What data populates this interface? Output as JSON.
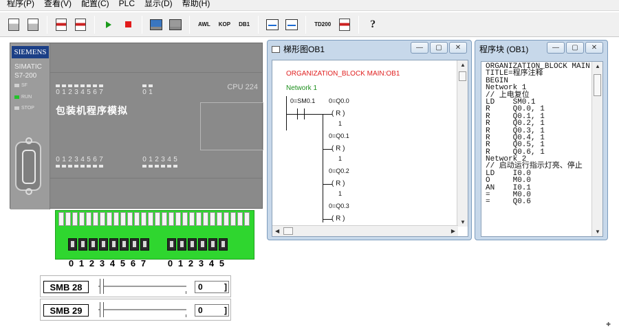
{
  "menubar": {
    "items": [
      "程序(P)",
      "查看(V)",
      "配置(C)",
      "PLC",
      "显示(D)",
      "帮助(H)"
    ]
  },
  "toolbar": {
    "awl_label": "AWL",
    "kop_label": "KOP",
    "db1_label": "DB1",
    "td200_label": "TD200",
    "help_glyph": "?"
  },
  "plc": {
    "brand": "SIEMENS",
    "series_line1": "SIMATIC",
    "series_line2": "S7-200",
    "led_sf": "SF",
    "led_run": "RUN",
    "led_stop": "STOP",
    "cpu_model": "CPU 224",
    "program_title": "包装机程序模拟",
    "input_nums_a": [
      "0",
      "1",
      "2",
      "3",
      "4",
      "5",
      "6",
      "7"
    ],
    "input_nums_b": [
      "0",
      "1"
    ],
    "output_nums_a": [
      "0",
      "1",
      "2",
      "3",
      "4",
      "5",
      "6",
      "7"
    ],
    "output_nums_b": [
      "0",
      "1",
      "2",
      "3",
      "4",
      "5"
    ]
  },
  "switches": {
    "nums_a": [
      "0",
      "1",
      "2",
      "3",
      "4",
      "5",
      "6",
      "7"
    ],
    "nums_b": [
      "0",
      "1",
      "2",
      "3",
      "4",
      "5"
    ]
  },
  "smb": [
    {
      "label": "SMB 28",
      "value": "0",
      "value_closing": "]"
    },
    {
      "label": "SMB 29",
      "value": "0",
      "value_closing": "]"
    }
  ],
  "ladder_window": {
    "title": "梯形图OB1",
    "org_block": "ORGANIZATION_BLOCK MAIN:OB1",
    "network": "Network 1",
    "contact": "0=SM0.1",
    "coils": [
      {
        "address": "0=Q0.0",
        "symbol": "( R )",
        "count": "1"
      },
      {
        "address": "0=Q0.1",
        "symbol": "( R )",
        "count": "1"
      },
      {
        "address": "0=Q0.2",
        "symbol": "( R )",
        "count": "1"
      },
      {
        "address": "0=Q0.3",
        "symbol": "( R )",
        "count": ""
      }
    ]
  },
  "stl_window": {
    "title": "程序块 (OB1)",
    "lines": [
      "ORGANIZATION_BLOCK MAIN:",
      "TITLE=程序注释",
      "BEGIN",
      "Network 1",
      "// 上电复位",
      "LD    SM0.1",
      "R     Q0.0, 1",
      "R     Q0.1, 1",
      "R     Q0.2, 1",
      "R     Q0.3, 1",
      "R     Q0.4, 1",
      "R     Q0.5, 1",
      "R     Q0.6, 1",
      "Network 2",
      "// 启动运行指示灯亮、停止",
      "LD    I0.0",
      "O     M0.0",
      "AN    I0.1",
      "=     M0.0",
      "=     Q0.6"
    ]
  },
  "colors": {
    "plc_body": "#8a8a8a",
    "siemens_blue": "#1b3f86",
    "terminal_green": "#2fd62f",
    "org_block_red": "#e02020",
    "network_green": "#1d8f1d"
  }
}
